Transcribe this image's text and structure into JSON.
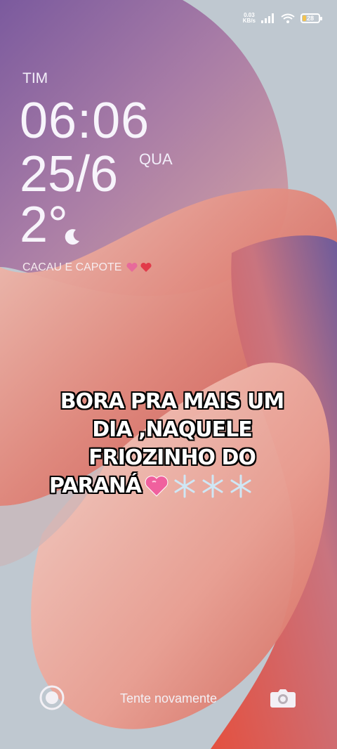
{
  "status": {
    "net_speed_value": "0.03",
    "net_speed_unit": "KB/s",
    "battery": "28",
    "battery_level": 0.28
  },
  "lockscreen": {
    "carrier": "TIM",
    "time": "06:06",
    "date": "25/6",
    "weekday": "QUA",
    "temperature": "2°",
    "note": "CACAU E CAPOTE"
  },
  "caption": {
    "lines": [
      "BORA PRA MAIS UM",
      "DIA ,NAQUELE",
      "FRIOZINHO DO",
      "PARANÁ"
    ]
  },
  "bottom": {
    "hint": "Tente novamente"
  },
  "icons": [
    "signal-icon",
    "wifi-icon",
    "battery-icon",
    "moon-icon",
    "heart-icon",
    "snowflake-icon",
    "record-icon",
    "camera-icon"
  ]
}
